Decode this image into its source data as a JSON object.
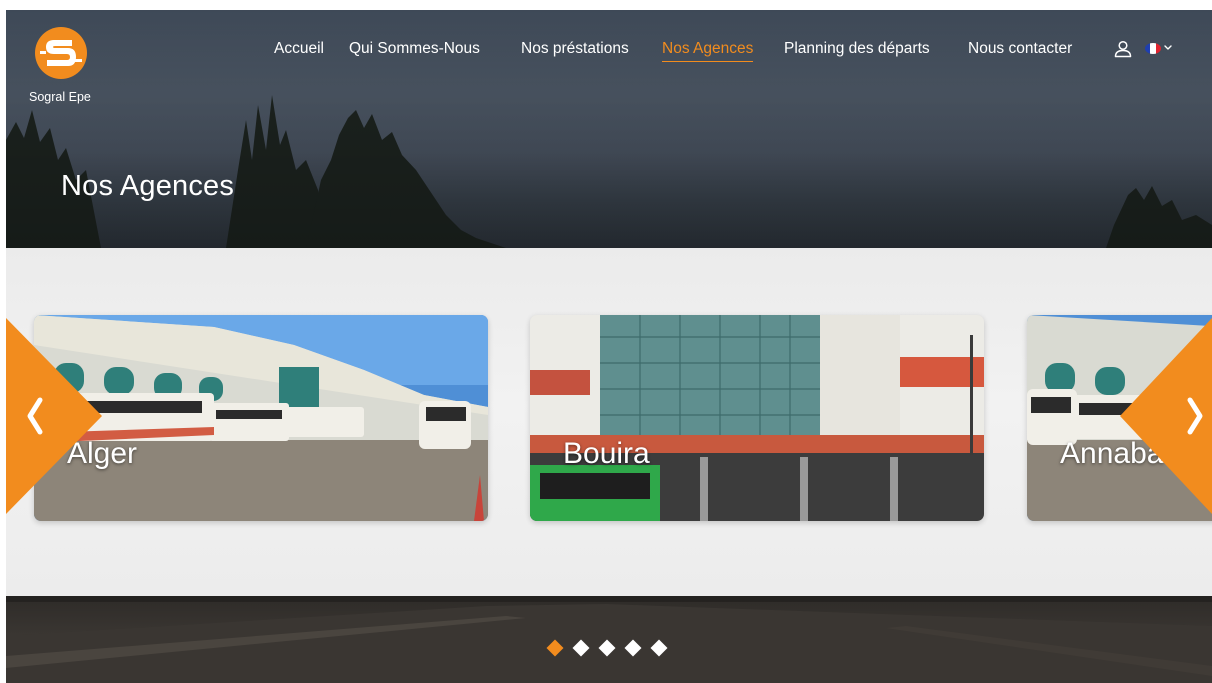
{
  "brand": {
    "name": "Sogral Epe",
    "accent": "#f28c1e"
  },
  "nav": {
    "items": [
      {
        "label": "Accueil",
        "active": false
      },
      {
        "label": "Qui Sommes-Nous",
        "active": false
      },
      {
        "label": "Nos préstations",
        "active": false
      },
      {
        "label": "Nos Agences",
        "active": true
      },
      {
        "label": "Planning des départs",
        "active": false
      },
      {
        "label": "Nous contacter",
        "active": false
      }
    ],
    "user_icon": "user-icon",
    "language": {
      "icon": "flag-fr-icon",
      "dropdown_icon": "chevron-down-icon"
    }
  },
  "hero": {
    "title": "Nos Agences"
  },
  "carousel": {
    "cards": [
      {
        "label": "Alger"
      },
      {
        "label": "Bouira"
      },
      {
        "label": "Annaba"
      }
    ],
    "prev_icon": "chevron-left-icon",
    "next_icon": "chevron-right-icon",
    "page_count": 5,
    "active_page": 1
  }
}
